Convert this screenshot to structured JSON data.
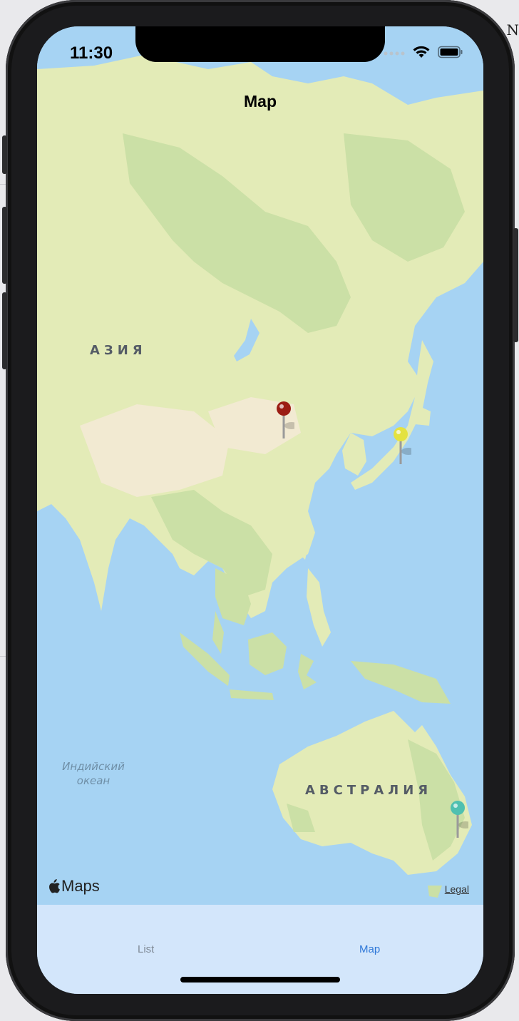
{
  "status_bar": {
    "time": "11:30",
    "icons": [
      "signal-icon",
      "wifi-icon",
      "battery-icon"
    ]
  },
  "nav": {
    "title": "Map"
  },
  "map": {
    "labels": {
      "asia": "АЗИЯ",
      "australia": "АВСТРАЛИЯ",
      "ocean_line1": "Индийский",
      "ocean_line2": "океан"
    },
    "attribution": {
      "brand": "Maps",
      "legal": "Legal"
    },
    "pins": [
      {
        "color": "#9b1d14",
        "label": ""
      },
      {
        "color": "#e4e240",
        "label": ""
      },
      {
        "color": "#4fc0b0",
        "label": ""
      }
    ],
    "colors": {
      "water": "#a6d3f3",
      "land": "#e3ebb7",
      "forest": "#cbe0a6",
      "desert": "#f2ead2"
    }
  },
  "tab_bar": {
    "tabs": [
      {
        "label": "List",
        "selected": false
      },
      {
        "label": "Map",
        "selected": true
      }
    ],
    "colors": {
      "selected": "#2f78d8",
      "unselected": "#7f8a96",
      "background": "#d3e6fb"
    }
  }
}
